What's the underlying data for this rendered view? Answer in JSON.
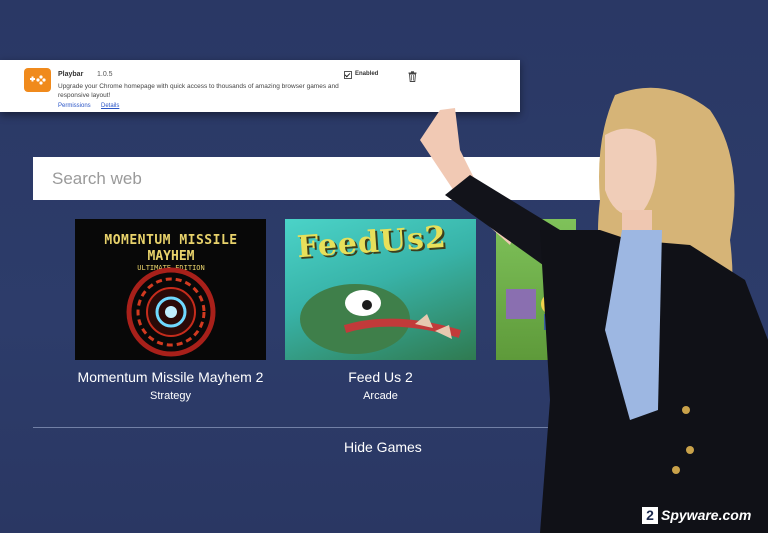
{
  "extension": {
    "name": "Playbar",
    "version": "1.0.5",
    "description": "Upgrade your Chrome homepage with quick access to thousands of amazing browser games and responsive layout!",
    "permissions_link": "Permissions",
    "details_link": "Details",
    "enabled_label": "Enabled",
    "enabled": true,
    "logo_color": "#f08a1c",
    "icons": {
      "logo": "gamepad-icon",
      "remove": "trash-icon"
    }
  },
  "search": {
    "placeholder": "Search web"
  },
  "games": [
    {
      "title": "Momentum Missile Mayhem 2",
      "genre": "Strategy",
      "thumb_lines": [
        "MOMENTUM MISSILE",
        "MAYHEM",
        "ULTIMATE EDITION"
      ]
    },
    {
      "title": "Feed Us 2",
      "genre": "Arcade",
      "thumb_text": "FeedUs2"
    },
    {
      "title": "",
      "genre": ""
    }
  ],
  "hide_games_label": "Hide Games",
  "watermark": {
    "digit": "2",
    "text": "Spyware.com"
  },
  "colors": {
    "background": "#2b3a66",
    "link": "#2a55c7",
    "text_light": "#ffffff"
  }
}
